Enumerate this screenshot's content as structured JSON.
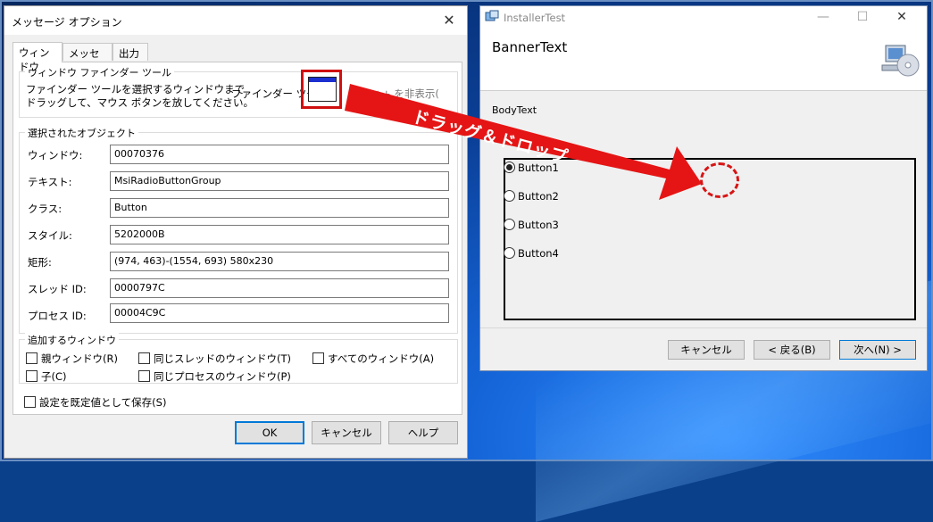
{
  "message_options": {
    "title": "メッセージ オプション",
    "tabs": [
      "ウィンドウ",
      "メッセージ",
      "出力"
    ],
    "finder_group": {
      "title": "ウィンドウ ファインダー ツール",
      "desc_line1": "ファインダー ツールを選択するウィンドウまで",
      "desc_line2": "ドラッグして、マウス ボタンを放してください。",
      "finder_label": "ファインダー ツール:",
      "hide_text": "Spy++ を非表示("
    },
    "selected_group": {
      "title": "選択されたオブジェクト",
      "fields": [
        {
          "label": "ウィンドウ:",
          "value": "00070376"
        },
        {
          "label": "テキスト:",
          "value": "MsiRadioButtonGroup"
        },
        {
          "label": "クラス:",
          "value": "Button"
        },
        {
          "label": "スタイル:",
          "value": "5202000B"
        },
        {
          "label": "矩形:",
          "value": "(974, 463)-(1554, 693) 580x230"
        },
        {
          "label": "スレッド ID:",
          "value": "0000797C"
        },
        {
          "label": "プロセス ID:",
          "value": "00004C9C"
        }
      ]
    },
    "additional_group": {
      "title": "追加するウィンドウ",
      "checkboxes": [
        "親ウィンドウ(R)",
        "同じスレッドのウィンドウ(T)",
        "すべてのウィンドウ(A)",
        "子(C)",
        "同じプロセスのウィンドウ(P)"
      ]
    },
    "save_default": "設定を既定値として保存(S)",
    "buttons": {
      "ok": "OK",
      "cancel": "キャンセル",
      "help": "ヘルプ"
    }
  },
  "installer": {
    "title": "InstallerTest",
    "banner_text": "BannerText",
    "body_text": "BodyText",
    "radio_buttons": [
      "Button1",
      "Button2",
      "Button3",
      "Button4"
    ],
    "selected_radio": "Button1",
    "buttons": {
      "cancel": "キャンセル",
      "back": "< 戻る(B)",
      "next": "次へ(N) >"
    }
  },
  "annotation": {
    "arrow_text": "ドラッグ＆ドロップ",
    "arrow_color": "#e51515",
    "highlight_color": "#d01010"
  }
}
